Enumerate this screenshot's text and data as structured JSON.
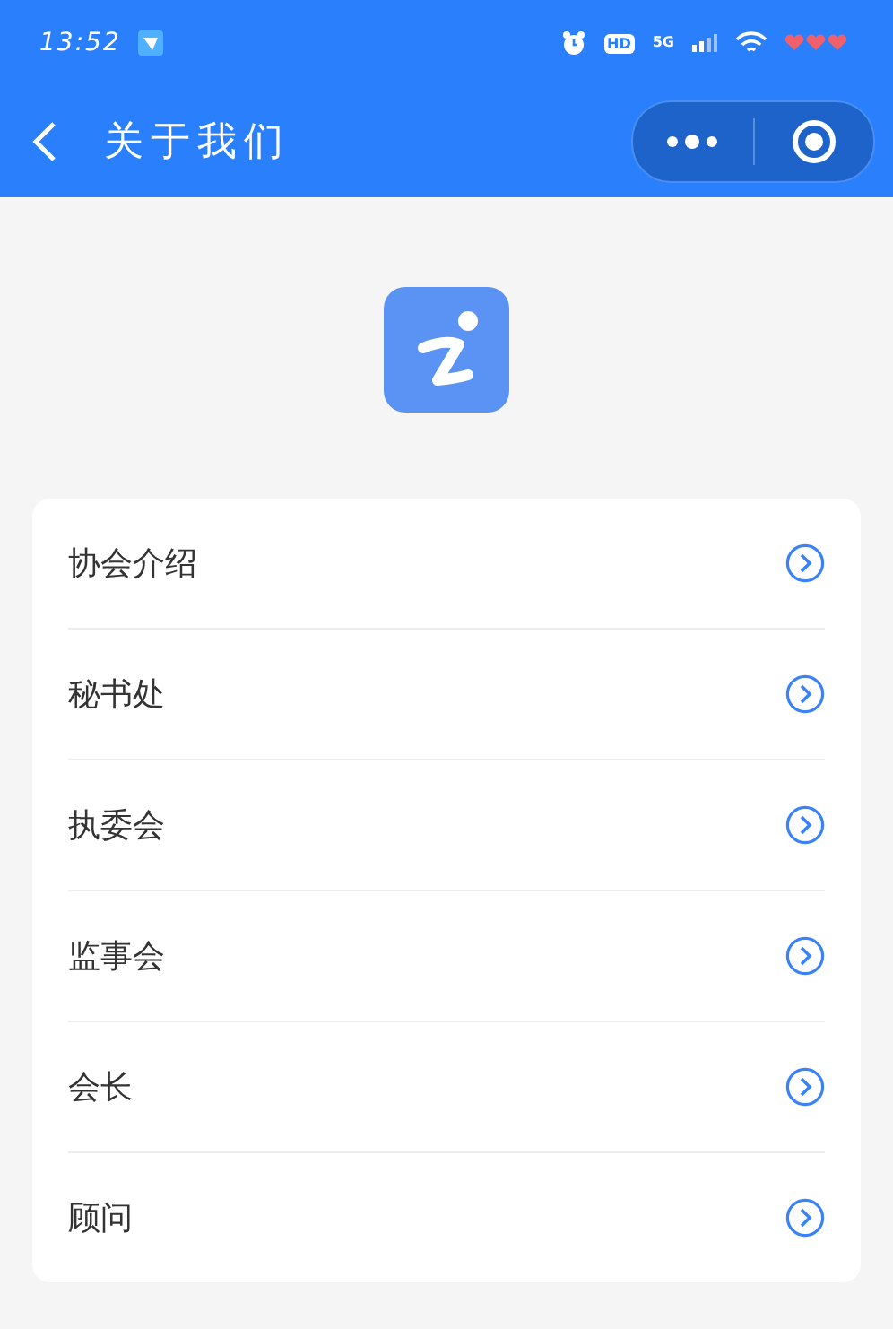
{
  "status_bar": {
    "time": "13:52",
    "hd_badge": "HD",
    "network": "5G"
  },
  "header": {
    "title": "关于我们"
  },
  "menu": [
    {
      "label": "协会介绍"
    },
    {
      "label": "秘书处"
    },
    {
      "label": "执委会"
    },
    {
      "label": "监事会"
    },
    {
      "label": "会长"
    },
    {
      "label": "顾问"
    }
  ]
}
